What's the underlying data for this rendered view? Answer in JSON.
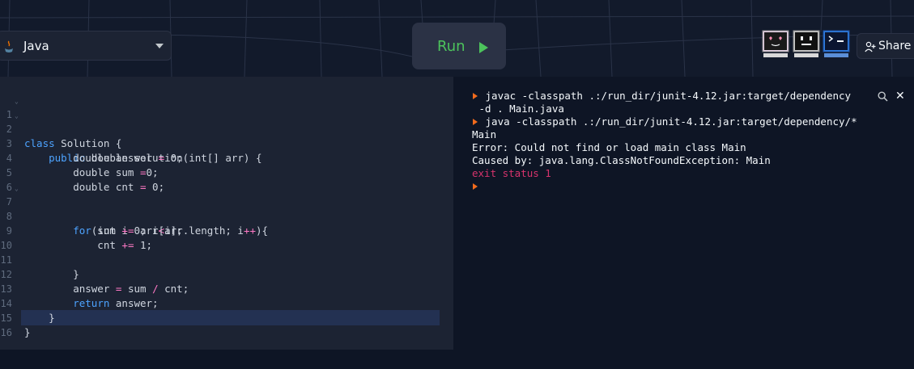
{
  "header": {
    "language": "Java",
    "run_label": "Run",
    "share_label": "Share",
    "avatars": [
      "heart-eyes-computer-icon",
      "neutral-face-computer-icon",
      "terminal-computer-icon"
    ]
  },
  "editor": {
    "lines": [
      {
        "n": "1",
        "text": "class Solution {"
      },
      {
        "n": "2",
        "text": "    public double solution(int[] arr) {"
      },
      {
        "n": "3",
        "text": "        double answer = 0;"
      },
      {
        "n": "4",
        "text": "        double sum =0;"
      },
      {
        "n": "5",
        "text": "        double cnt = 0;"
      },
      {
        "n": "6",
        "text": ""
      },
      {
        "n": "7",
        "text": "        for(int i=0; i<arr.length; i++){"
      },
      {
        "n": "8",
        "text": "            sum += arr[i];"
      },
      {
        "n": "9",
        "text": "            cnt += 1;"
      },
      {
        "n": "10",
        "text": ""
      },
      {
        "n": "11",
        "text": "        }"
      },
      {
        "n": "12",
        "text": "        answer = sum / cnt;"
      },
      {
        "n": "13",
        "text": "        return answer;"
      },
      {
        "n": "14",
        "text": "    }"
      },
      {
        "n": "15",
        "text": "}"
      },
      {
        "n": "16",
        "text": ""
      }
    ]
  },
  "console": {
    "lines": [
      {
        "prompt": true,
        "text": " javac -classpath .:/run_dir/junit-4.12.jar:target/dependency",
        "color": "#f5f9fc"
      },
      {
        "prompt": false,
        "text": " -d . Main.java",
        "color": "#f5f9fc"
      },
      {
        "prompt": true,
        "text": " java -classpath .:/run_dir/junit-4.12.jar:target/dependency/*",
        "color": "#f5f9fc"
      },
      {
        "prompt": false,
        "text": "Main",
        "color": "#f5f9fc"
      },
      {
        "prompt": false,
        "text": "Error: Could not find or load main class Main",
        "color": "#f5f9fc"
      },
      {
        "prompt": false,
        "text": "Caused by: java.lang.ClassNotFoundException: Main",
        "color": "#f5f9fc"
      },
      {
        "prompt": false,
        "text": "exit status 1",
        "color": "#d6336c"
      },
      {
        "prompt": true,
        "text": "",
        "color": "#f5f9fc"
      }
    ]
  },
  "colors": {
    "accent_green": "#4cc35c",
    "prompt_orange": "#f26b1d",
    "error_red": "#d6336c",
    "keyword_blue": "#4da3ff"
  }
}
